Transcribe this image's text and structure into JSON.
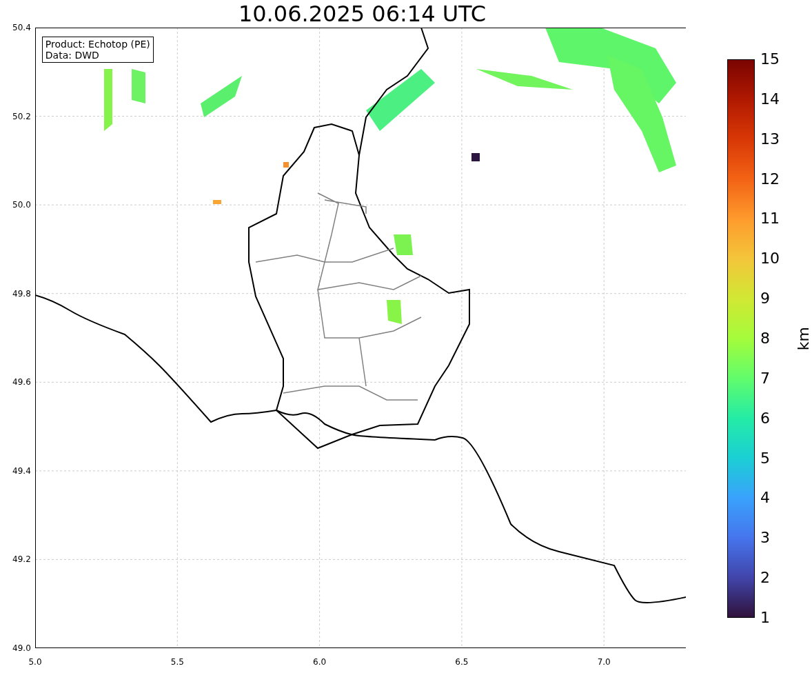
{
  "title": "10.06.2025 06:14 UTC",
  "plot": {
    "legend": [
      "Product: Echotop (PE)",
      "Data: DWD"
    ],
    "y_axis": {
      "ticks": [
        "50.4",
        "50.2",
        "50.0",
        "49.8",
        "49.6",
        "49.4",
        "49.2",
        "49.0"
      ]
    },
    "x_axis": {
      "ticks": [
        "5.0",
        "5.5",
        "6.0",
        "6.5",
        "7.0"
      ]
    }
  },
  "colorbar": {
    "label": "km",
    "ticks": [
      "15",
      "14",
      "13",
      "12",
      "11",
      "10",
      "9",
      "8",
      "7",
      "6",
      "5",
      "4",
      "3",
      "2",
      "1"
    ]
  }
}
